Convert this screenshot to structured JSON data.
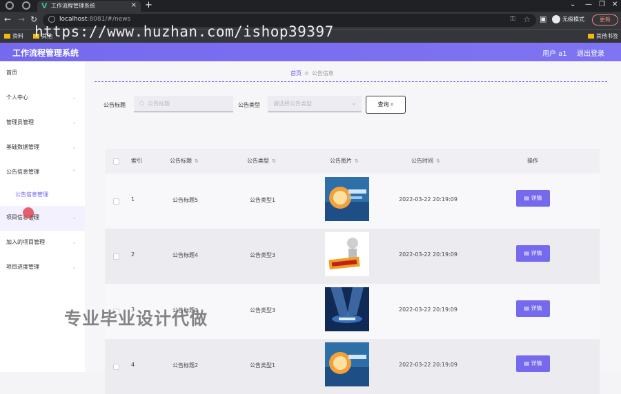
{
  "browser": {
    "tab_title": "工作流程管理系统",
    "url_host": "localhost",
    "url_rest": ":8081/#/news",
    "incognito_label": "无痕模式",
    "update_label": "更新",
    "bookmarks": [
      "资料",
      "其他"
    ],
    "other_bookmarks": "其他书签"
  },
  "watermark": {
    "url_text": "https://www.huzhan.com/ishop39397",
    "text": "专业毕业设计代做"
  },
  "header": {
    "title": "工作流程管理系统",
    "user": "用户 a1",
    "logout": "退出登录"
  },
  "sidebar": {
    "items": [
      {
        "label": "首页"
      },
      {
        "label": "个人中心"
      },
      {
        "label": "管理员管理"
      },
      {
        "label": "基础数据管理"
      },
      {
        "label": "公告信息管理"
      },
      {
        "label": "项目信息管理"
      },
      {
        "label": "加入的项目管理"
      },
      {
        "label": "项目进度管理"
      }
    ],
    "submenu": "公告信息管理"
  },
  "breadcrumb": {
    "home": "首页",
    "current": "公告信息"
  },
  "search": {
    "title_label": "公告标题",
    "title_placeholder": "公告标题",
    "type_label": "公告类型",
    "type_placeholder": "请选择公告类型",
    "query_button": "查询"
  },
  "table": {
    "headers": {
      "index": "索引",
      "title": "公告标题",
      "type": "公告类型",
      "image": "公告图片",
      "time": "公告时间",
      "action": "操作"
    },
    "rows": [
      {
        "index": "1",
        "title": "公告标题5",
        "type": "公告类型1",
        "time": "2022-03-22 20:19:09",
        "action": "详情"
      },
      {
        "index": "2",
        "title": "公告标题4",
        "type": "公告类型3",
        "time": "2022-03-22 20:19:09",
        "action": "详情"
      },
      {
        "index": "3",
        "title": "公告标题3",
        "type": "公告类型3",
        "time": "2022-03-22 20:19:09",
        "action": "详情"
      },
      {
        "index": "4",
        "title": "公告标题2",
        "type": "公告类型1",
        "time": "2022-03-22 20:19:09",
        "action": "详情"
      }
    ]
  },
  "colors": {
    "accent": "#7569ee",
    "browser_dark": "#202124"
  }
}
